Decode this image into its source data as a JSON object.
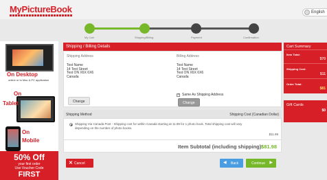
{
  "header": {
    "logo_text": "MyPictureBook",
    "language": "English"
  },
  "steps": [
    {
      "label": "My Cart",
      "state": "done"
    },
    {
      "label": "Shipping/Billing",
      "state": "current"
    },
    {
      "label": "Payment",
      "state": "todo"
    },
    {
      "label": "Confirmation",
      "state": "todo"
    }
  ],
  "promo": {
    "desktop": "On Desktop",
    "desktop_sub": "online or to Mac & PC application",
    "on": "On",
    "tablet": "Tablet",
    "mobile_on": "On",
    "mobile": "Mobile",
    "offer_pct": "50% Off",
    "offer_line1": "your first order",
    "offer_line2": "Use Voucher Code",
    "offer_code": "FIRST"
  },
  "details": {
    "title": "Shipping / Billing Details",
    "shipping": {
      "heading": "Shipping Address",
      "lines": [
        "Test Name",
        "14 Test Street",
        "Test ON X6X 6X6",
        "Canada"
      ],
      "change": "Change"
    },
    "billing": {
      "heading": "Billing Address",
      "lines": [
        "Test Name",
        "14 Test Street",
        "Test ON X6X 6X6",
        "Canada"
      ],
      "same_label": "Same As Shipping Address",
      "change": "Change"
    }
  },
  "shipping_method": {
    "heading": "Shipping Method",
    "cost_heading": "Shipping Cost (Canadian Dollar)",
    "description": "Shipping Via Canada Post - Shipping cost for within Canada starting at 11.99 for 1 photo book. Total shipping cost will vary depending on the number of photo books.",
    "amount": "$11.99"
  },
  "subtotal": {
    "label": "Item Subtotal (including shipping):",
    "value": "$81.98"
  },
  "actions": {
    "cancel": "Cancel",
    "back": "Back",
    "continue": "Continue"
  },
  "cart": {
    "title": "Cart Summary",
    "item_total_label": "Item Total:",
    "item_total": "$70",
    "shipping_label": "Shipping Cost:",
    "shipping": "$11",
    "order_total_label": "Order Total:",
    "order_total": "$81"
  },
  "gift": {
    "title": "Gift Cards",
    "value": "$0"
  },
  "colors": {
    "brand_red": "#d61f26",
    "progress_green": "#76b82a",
    "back_blue": "#4a9de0"
  }
}
